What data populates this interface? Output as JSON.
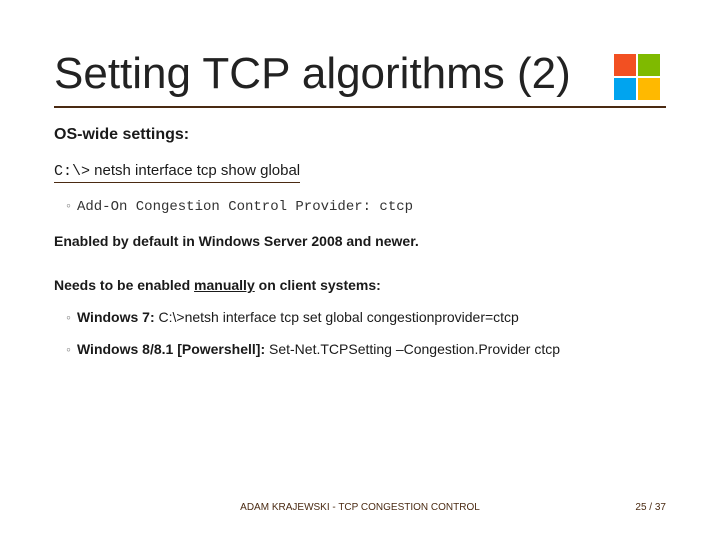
{
  "title": "Setting TCP algorithms (2)",
  "subheading": "OS-wide settings:",
  "cmd_prompt": "C:\\>",
  "cmd_text": " netsh interface tcp show global",
  "addon_bullet": "Add-On Congestion Control Provider: ctcp",
  "enabled_line": "Enabled by default in Windows Server 2008 and newer.",
  "needs_pre": "Needs to be enabled ",
  "needs_underlined": "manually",
  "needs_post": " on client systems:",
  "win7_label": "Windows 7:",
  "win7_cmd": "  C:\\>netsh interface tcp set global congestionprovider=ctcp",
  "win8_label": "Windows 8/8.1 [Powershell]:",
  "win8_cmd": "  Set-Net.TCPSetting –Congestion.Provider ctcp",
  "footer_center": "ADAM KRAJEWSKI - TCP CONGESTION CONTROL",
  "page_current": "25",
  "page_sep": " / ",
  "page_total": "37"
}
